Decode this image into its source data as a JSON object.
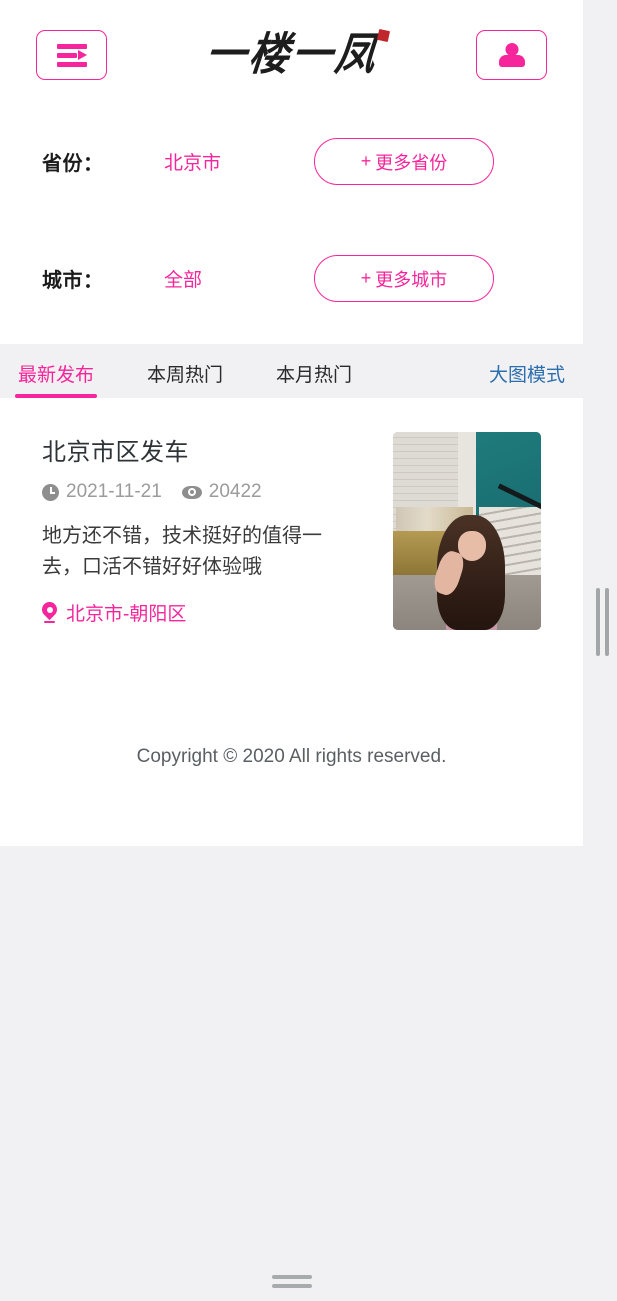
{
  "header": {
    "menu_icon": "menu-list-arrow-icon",
    "logo_text": "一楼一凤",
    "logo_seal": "red-seal-mark",
    "account_icon": "person-icon"
  },
  "filters": [
    {
      "label": "省份：",
      "value": "北京市",
      "button_plus": "+",
      "button_label": "更多省份"
    },
    {
      "label": "城市：",
      "value": "全部",
      "button_plus": "+",
      "button_label": "更多城市"
    }
  ],
  "tabs": [
    {
      "label": "最新发布",
      "active": true
    },
    {
      "label": "本周热门",
      "active": false
    },
    {
      "label": "本月热门",
      "active": false
    }
  ],
  "view_mode_link": "大图模式",
  "posts": [
    {
      "title": "北京市区发车",
      "date_icon": "clock-icon",
      "date": "2021-11-21",
      "views_icon": "eye-icon",
      "views": "20422",
      "description": "地方还不错，技术挺好的值得一去，口活不错好好体验哦",
      "location_icon": "location-pin-icon",
      "location": "北京市-朝阳区",
      "thumbnail": "post-photo-thumbnail"
    }
  ],
  "footer": {
    "copyright": "Copyright © 2020 All rights reserved."
  },
  "colors": {
    "accent_pink": "#f7259b",
    "link_blue": "#2d6fae",
    "page_bg": "#f1f1f3",
    "card_bg": "#ffffff",
    "seal_red": "#c0272d",
    "muted_text": "#9b9b9b"
  }
}
